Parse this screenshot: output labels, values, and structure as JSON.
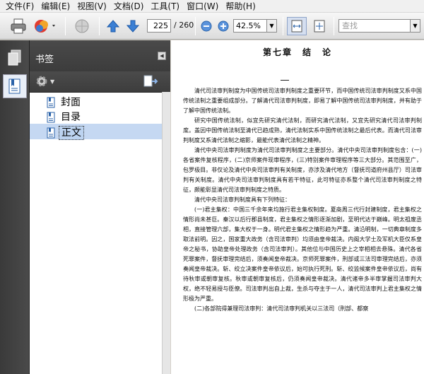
{
  "menu": [
    "文件(F)",
    "编辑(E)",
    "视图(V)",
    "文档(D)",
    "工具(T)",
    "窗口(W)",
    "帮助(H)"
  ],
  "toolbar": {
    "page_current": "225",
    "page_total": "/ 260",
    "zoom": "42.5%",
    "search_placeholder": "查找"
  },
  "panel": {
    "title": "书签",
    "bookmarks": [
      {
        "label": "封面",
        "selected": false
      },
      {
        "label": "目录",
        "selected": false
      },
      {
        "label": "正文",
        "selected": true
      }
    ]
  },
  "document": {
    "chapter_title": "第七章　结　论",
    "paragraphs": [
      "清代司法审判制度为中国传统司法审判制度之重要环节，而中国传统司法审判制度又系中国传统法制之重要组成部分。了解清代司法审判制度，即易了解中国传统司法审判制度，并有助于了解中国传统法制。",
      "研究中国传统法制，似宜先研究清代法制，而研究清代法制，又宜先研究清代司法审判制度。盖因中国传统法制至清代已趋成熟，清代法制实系中国传统法制之最后代表。而清代司法审判制度又系清代法制之缩影，最能代表清代法制之精神。",
      "清代中央司法审判制度为清代司法审判制度之主要部分。清代中央司法审判制度包含：(一)各省案件复核程序，(二)京师案件现审程序，(三)特别案件审理程序等三大部分。其范围至广，包罗极目。非仅论及清代中央司法审判有关制度，亦涉及清代地方（督抚司道府州县厅）司法审判有关制度。清代中央司法审判制度具有若干特征，此可特征亦系整个清代司法审判制度之特征，颇能彰显清代司法审判制度之特质。",
      "清代中央司法审判制度具有下列特征：",
      "(一)君主集权：中国三千余年来均施行君主集权制度。夏商周三代行封建制度，君主集权之情形尚未甚巨。秦汉以后行郡县制度，君主集权之情形逐渐加剧，至明代达于巅峰。明太祖废丞相，直接管理六部，集大权于一身。明代君主集权之情形趋为严重。清沿明制，一切典章制度多取法前明。因之，国家重大政务（含司法审判）均须由皇帝裁决。内阁大学士及军机大臣仅系皇帝之秘书，协助皇帝处理政务（含司法审判）。其他位与中国历史上之宰相相去悬殊。清代各省死罪案件，督抚审理完结后，须奏闻皇帝裁决。京师死罪案件，刑部或三法司审理完结后，亦须奏闻皇帝裁决。斩、绞立决案件皇帝依议后，始可执行死刑。斩、绞监候案件皇帝依议后，尚有待秋审或朝审复核。秋审或朝审复核后，仍须奏闻皇帝裁决。清代诸帝多半审掌握司法审判大权，绝不轻易授与臣僚。司法审判出自上裁，生杀与夺主于一人，清代司法审判上君主集权之情形极为严重。",
      "(二)各部院得兼理司法审判：清代司法审判机关以三法司（刑部、都察"
    ]
  }
}
